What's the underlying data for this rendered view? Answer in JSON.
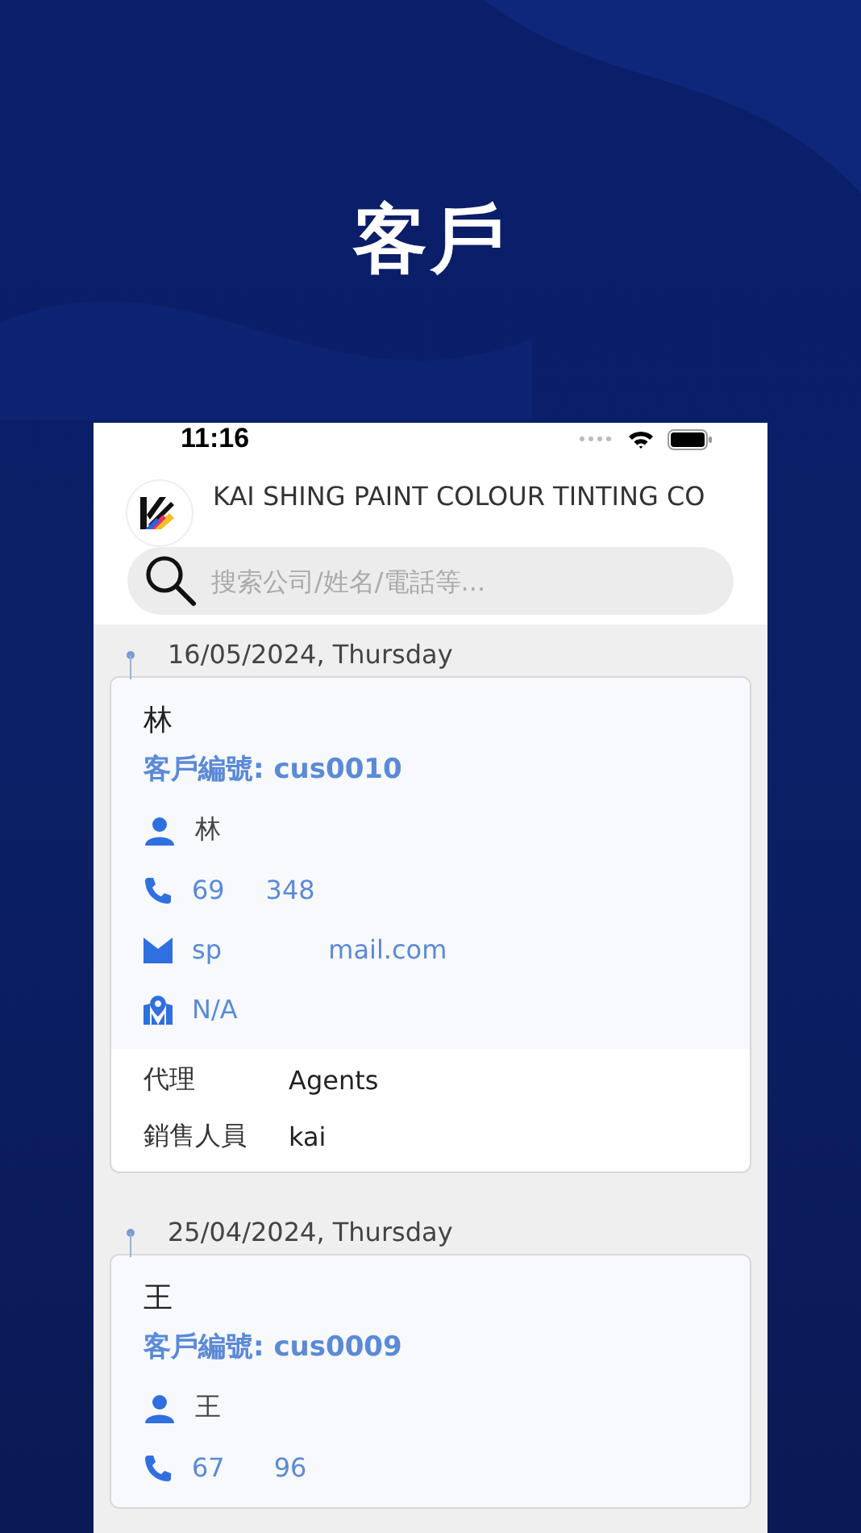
{
  "screen_title": "客戶",
  "status_bar": {
    "time": "11:16"
  },
  "company": {
    "name": "KAI SHING PAINT COLOUR TINTING CO"
  },
  "search": {
    "placeholder": "搜索公司/姓名/電話等..."
  },
  "entries": [
    {
      "date": "16/05/2024, Thursday",
      "name": "林",
      "customer_no": "客戶編號: cus0010",
      "contacts": [
        {
          "kind": "person",
          "text": "林"
        },
        {
          "kind": "phone",
          "text": "69     348"
        },
        {
          "kind": "email",
          "text": "sp             mail.com"
        },
        {
          "kind": "location",
          "text": "N/A"
        }
      ],
      "details": [
        {
          "label": "代理",
          "value": "Agents"
        },
        {
          "label": "銷售人員",
          "value": "kai"
        }
      ]
    },
    {
      "date": "25/04/2024, Thursday",
      "name": "王",
      "customer_no": "客戶編號: cus0009",
      "contacts": [
        {
          "kind": "person",
          "text": "王"
        },
        {
          "kind": "phone",
          "text": "67      96"
        }
      ]
    }
  ]
}
